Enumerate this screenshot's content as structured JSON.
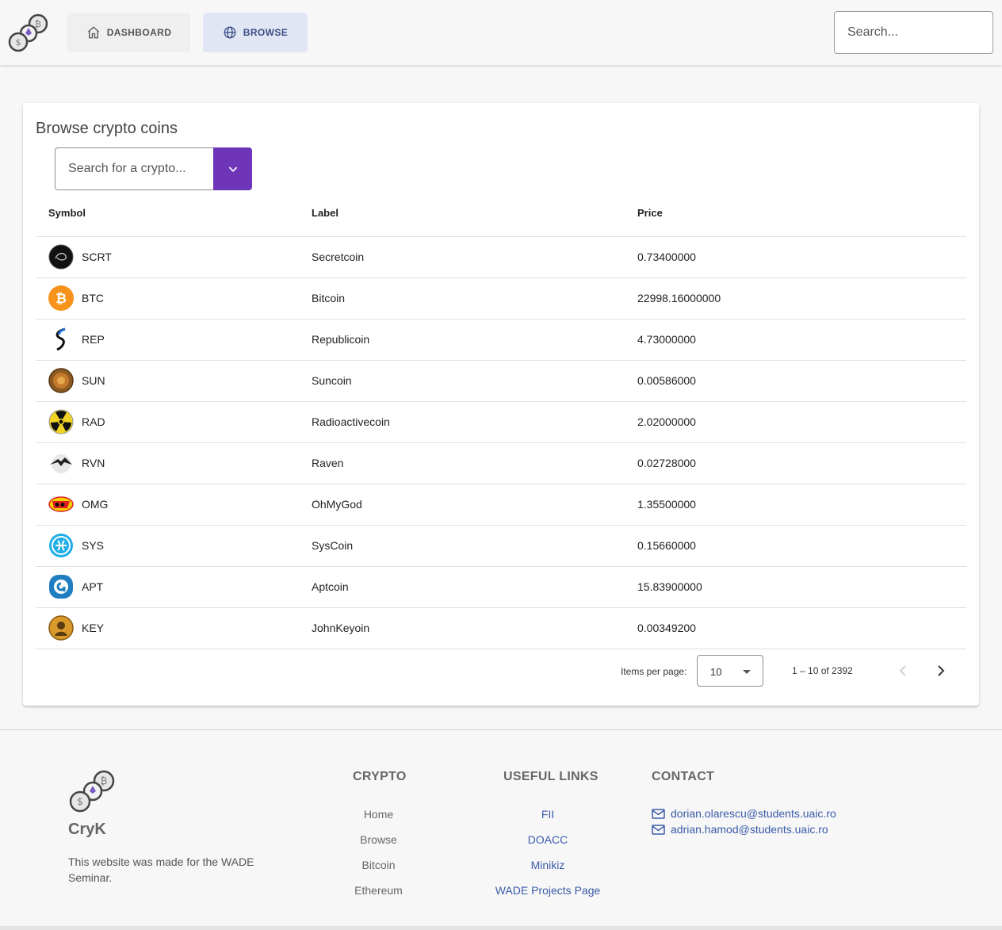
{
  "header": {
    "nav": [
      {
        "label": "DASHBOARD",
        "icon": "home-icon"
      },
      {
        "label": "BROWSE",
        "icon": "globe-icon"
      }
    ],
    "search_placeholder": "Search..."
  },
  "browse": {
    "title": "Browse crypto coins",
    "search_placeholder": "Search for a crypto...",
    "columns": [
      "Symbol",
      "Label",
      "Price"
    ],
    "rows": [
      {
        "symbol": "SCRT",
        "label": "Secretcoin",
        "price": "0.73400000",
        "icon": "secretcoin-icon"
      },
      {
        "symbol": "BTC",
        "label": "Bitcoin",
        "price": "22998.16000000",
        "icon": "bitcoin-icon"
      },
      {
        "symbol": "REP",
        "label": "Republicoin",
        "price": "4.73000000",
        "icon": "republicoin-icon"
      },
      {
        "symbol": "SUN",
        "label": "Suncoin",
        "price": "0.00586000",
        "icon": "suncoin-icon"
      },
      {
        "symbol": "RAD",
        "label": "Radioactivecoin",
        "price": "2.02000000",
        "icon": "radioactive-icon"
      },
      {
        "symbol": "RVN",
        "label": "Raven",
        "price": "0.02728000",
        "icon": "raven-icon"
      },
      {
        "symbol": "OMG",
        "label": "OhMyGod",
        "price": "1.35500000",
        "icon": "omg-icon"
      },
      {
        "symbol": "SYS",
        "label": "SysCoin",
        "price": "0.15660000",
        "icon": "syscoin-icon"
      },
      {
        "symbol": "APT",
        "label": "Aptcoin",
        "price": "15.83900000",
        "icon": "aptcoin-icon"
      },
      {
        "symbol": "KEY",
        "label": "JohnKeyoin",
        "price": "0.00349200",
        "icon": "johnkeyoin-icon"
      }
    ],
    "paginator": {
      "label": "Items per page:",
      "page_size": "10",
      "range": "1 – 10 of 2392"
    }
  },
  "footer": {
    "brand": "CryK",
    "about": "This website was made for the WADE Seminar.",
    "crypto": {
      "title": "CRYPTO",
      "links": [
        "Home",
        "Browse",
        "Bitcoin",
        "Ethereum"
      ]
    },
    "useful": {
      "title": "USEFUL LINKS",
      "links": [
        "FII",
        "DOACC",
        "Minikiz",
        "WADE Projects Page"
      ]
    },
    "contact": {
      "title": "CONTACT",
      "emails": [
        "dorian.olarescu@students.uaic.ro",
        "adrian.hamod@students.uaic.ro"
      ]
    }
  },
  "colors": {
    "accent": "#6f35b8",
    "nav_active_bg": "#e1e6f4",
    "link": "#3a5ba8"
  }
}
